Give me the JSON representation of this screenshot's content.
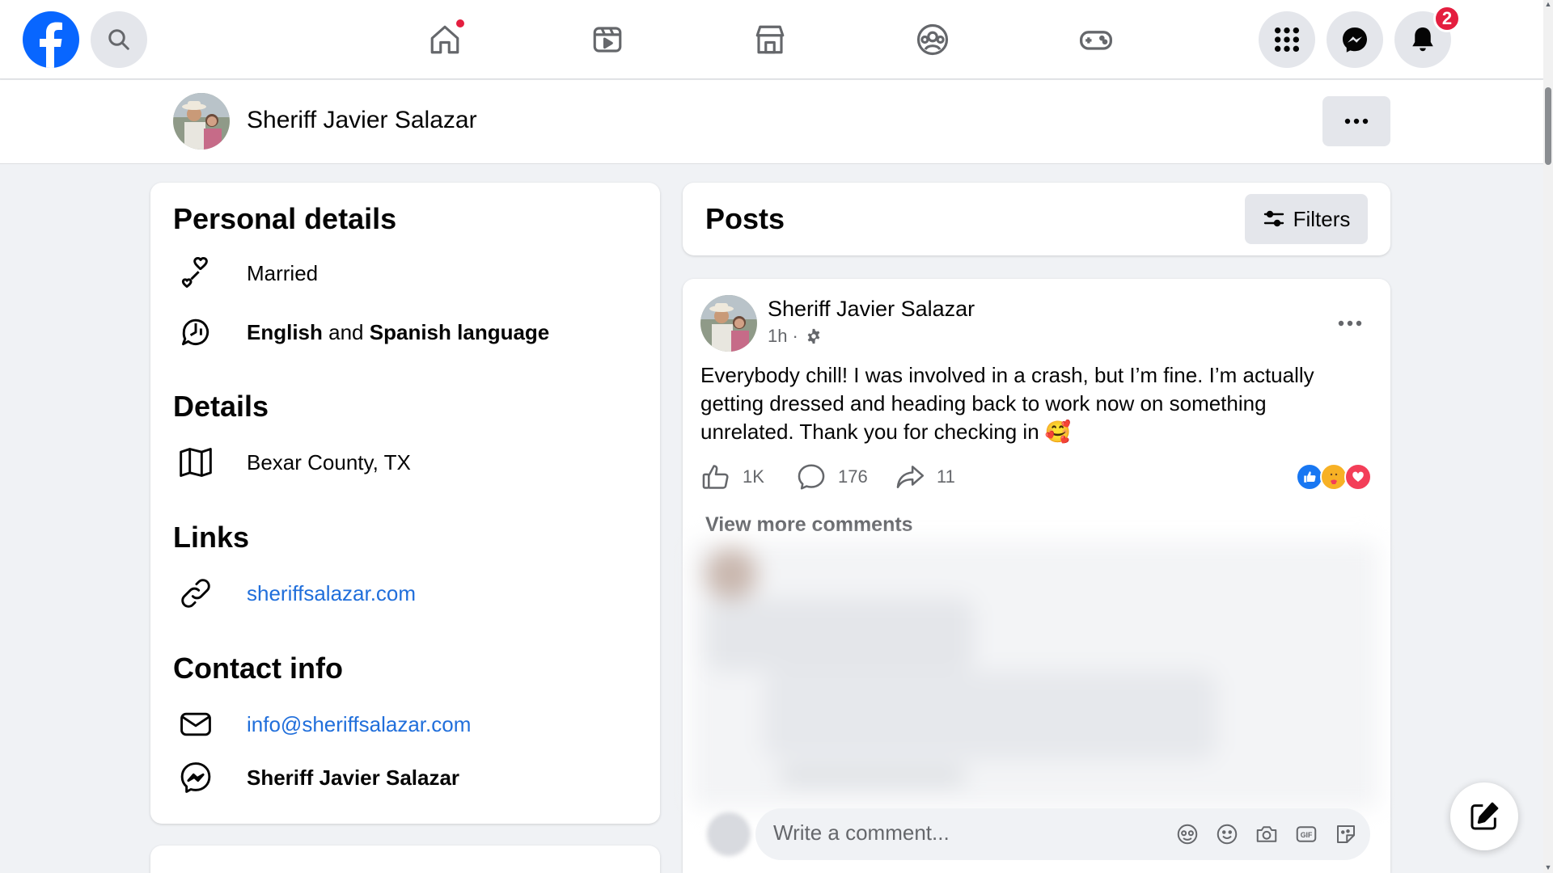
{
  "nav": {
    "logo": "facebook-logo",
    "search": "search-icon",
    "tabs": [
      {
        "name": "home",
        "icon": "home-icon",
        "has_dot": true
      },
      {
        "name": "video",
        "icon": "video-icon"
      },
      {
        "name": "marketplace",
        "icon": "marketplace-icon"
      },
      {
        "name": "groups",
        "icon": "groups-icon"
      },
      {
        "name": "gaming",
        "icon": "gaming-icon"
      }
    ],
    "right": [
      {
        "name": "menu",
        "icon": "grid-icon"
      },
      {
        "name": "messenger",
        "icon": "messenger-icon"
      },
      {
        "name": "notifications",
        "icon": "bell-icon",
        "badge": "2"
      }
    ]
  },
  "profile": {
    "name": "Sheriff Javier Salazar",
    "more_icon": "ellipsis-icon"
  },
  "intro": {
    "personal_title": "Personal details",
    "relationship": "Married",
    "languages": {
      "lang1": "English",
      "and": "and",
      "lang2": "Spanish",
      "suffix": "language"
    },
    "details_title": "Details",
    "location": "Bexar County, TX",
    "links_title": "Links",
    "website": "sheriffsalazar.com",
    "contact_title": "Contact info",
    "email": "info@sheriffsalazar.com",
    "messenger": "Sheriff Javier Salazar"
  },
  "posts": {
    "title": "Posts",
    "filters_label": "Filters"
  },
  "post": {
    "author": "Sheriff Javier Salazar",
    "time": "1h",
    "separator": "·",
    "text": "Everybody chill! I was involved in a crash, but I’m fine. I’m actually getting dressed and heading back to work now on something unrelated.  Thank you for checking in 🥰",
    "likes": "1K",
    "comments": "176",
    "shares": "11",
    "reactions": [
      "like",
      "care",
      "love"
    ],
    "view_more": "View more comments",
    "comment_placeholder": "Write a comment..."
  },
  "colors": {
    "brand": "#0866ff",
    "link": "#216fdb",
    "notification": "#e41e3f",
    "background": "#f0f2f5"
  }
}
